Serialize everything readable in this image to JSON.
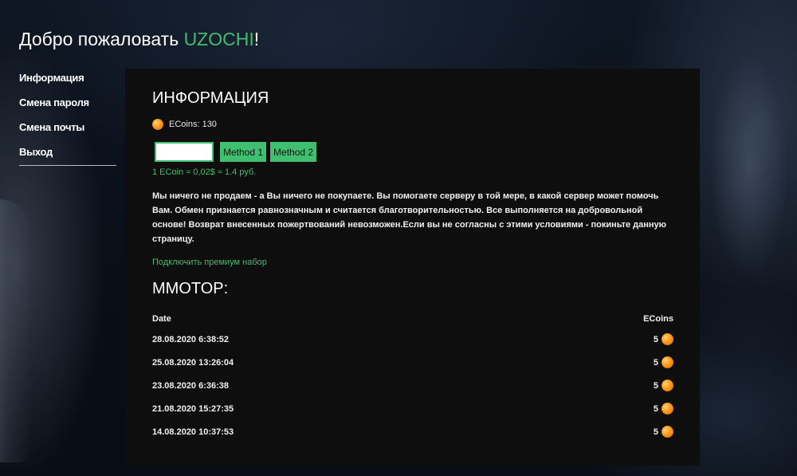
{
  "header": {
    "welcome_prefix": "Добро пожаловать ",
    "username": "UZOCHI",
    "welcome_suffix": "!"
  },
  "sidebar": {
    "items": [
      {
        "label": "Информация"
      },
      {
        "label": "Смена пароля"
      },
      {
        "label": "Смена почты"
      },
      {
        "label": "Выход"
      }
    ]
  },
  "info": {
    "title": "ИНФОРМАЦИЯ",
    "ecoins_label": "ECoins: 130",
    "coin_icon": "coin-icon",
    "amount_input_value": "",
    "method1_label": "Method 1",
    "method2_label": "Method 2",
    "rate_text": "1 ECoin ≈ 0,02$ ≈ 1.4 руб.",
    "description": "Мы ничего не продаем - а Вы ничего не покупаете. Вы помогаете серверу в той мере, в какой сервер может помочь Вам. Обмен признается равнозначным и считается благотворительностью. Все выполняется на добровольной основе! Возврат внесенных пожертвований невозможен.Если вы не согласны с этими условиями - покиньте данную страницу.",
    "premium_link": "Подключить премиум набор"
  },
  "mmotop": {
    "title": "MMOTOP:",
    "columns": {
      "date": "Date",
      "ecoins": "ECoins"
    },
    "rows": [
      {
        "date": "28.08.2020 6:38:52",
        "value": "5"
      },
      {
        "date": "25.08.2020 13:26:04",
        "value": "5"
      },
      {
        "date": "23.08.2020 6:36:38",
        "value": "5"
      },
      {
        "date": "21.08.2020 15:27:35",
        "value": "5"
      },
      {
        "date": "14.08.2020 10:37:53",
        "value": "5"
      }
    ]
  },
  "colors": {
    "accent": "#3fbf6f",
    "panel_bg": "#0e0e0e",
    "coin": "#ff9a1a"
  }
}
